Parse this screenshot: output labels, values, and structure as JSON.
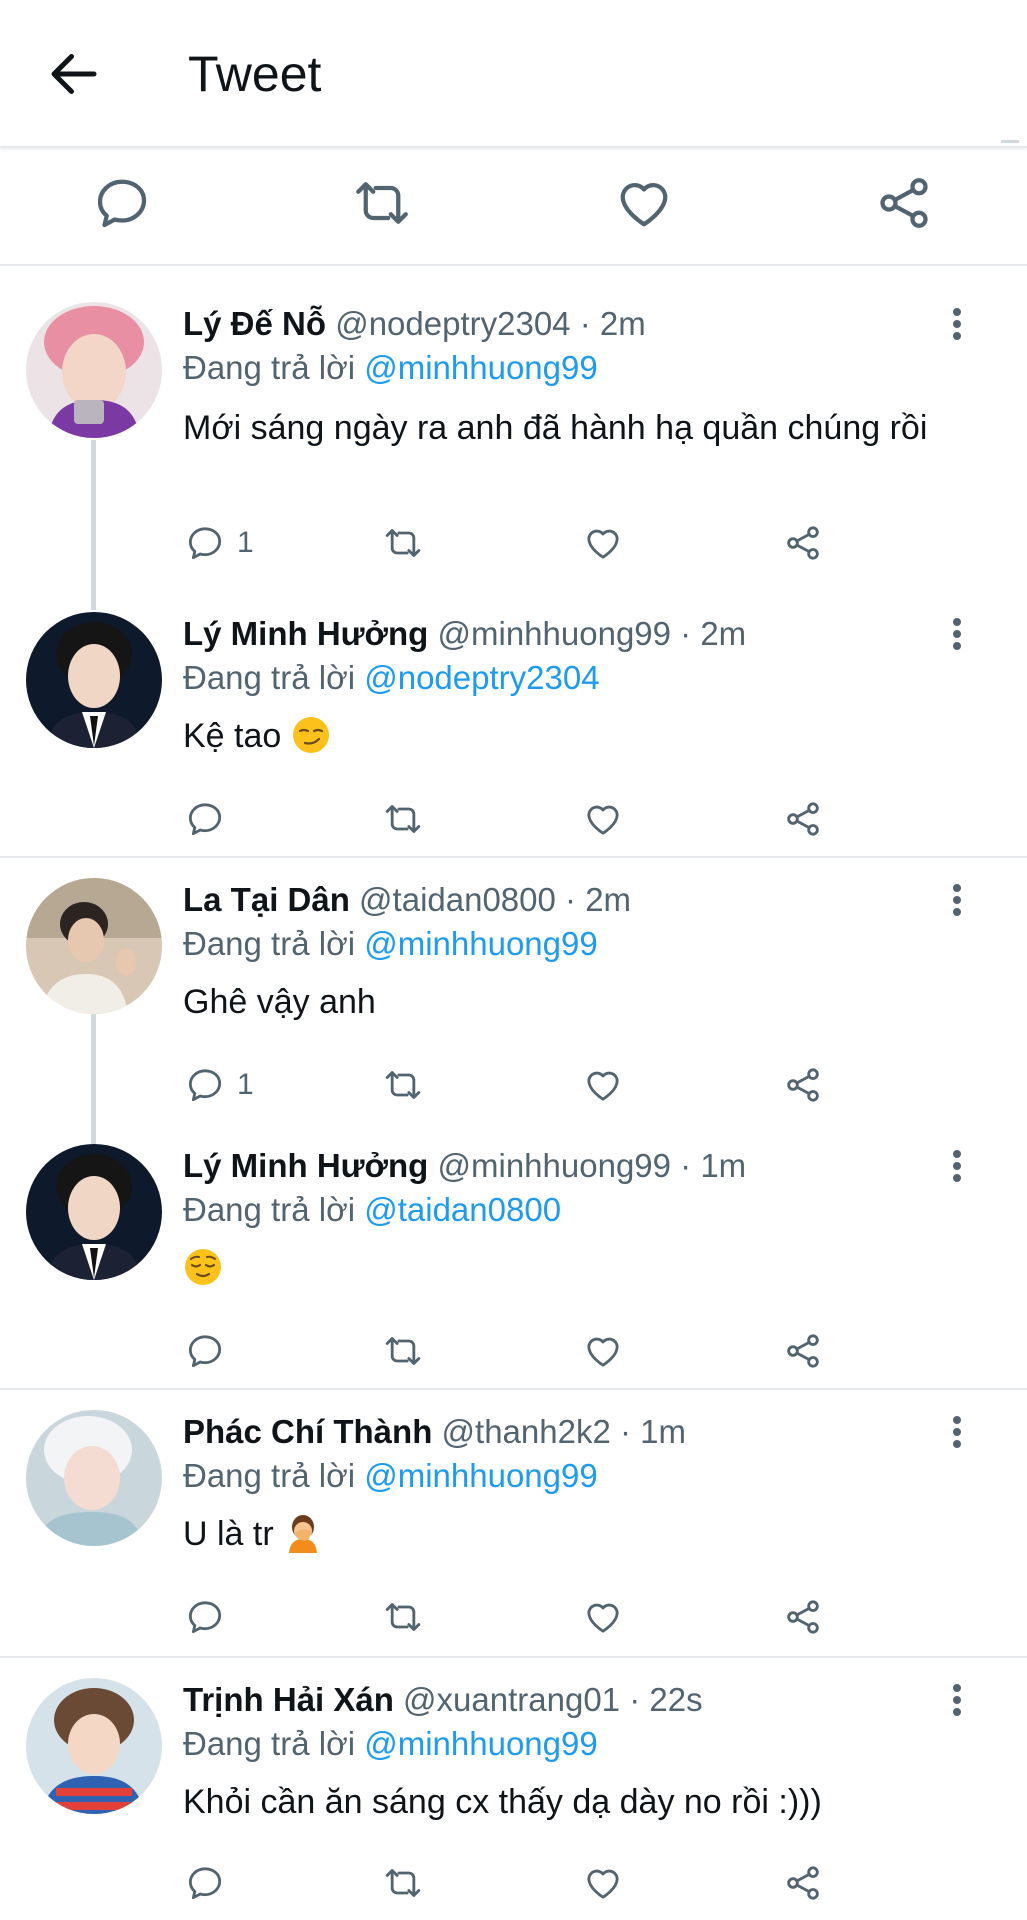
{
  "header": {
    "title": "Tweet"
  },
  "replying_prefix": "Đang trả lời",
  "colors": {
    "accent": "#1d9bf0",
    "secondary_text": "#536471",
    "divider": "#e6e9ec"
  },
  "tweets": [
    {
      "name": "Lý Đế Nỗ",
      "handle": "@nodeptry2304",
      "time": "· 2m",
      "reply_to": "@minhhuong99",
      "text": "Mới sáng ngày ra anh đã hành hạ quần chúng rồi",
      "emoji": "",
      "reply_count": "1"
    },
    {
      "name": "Lý Minh Hưởng",
      "handle": "@minhhuong99",
      "time": "· 2m",
      "reply_to": "@nodeptry2304",
      "text": "Kệ tao",
      "emoji": "smirking-face",
      "reply_count": ""
    },
    {
      "name": "La Tại Dân",
      "handle": "@taidan0800",
      "time": "· 2m",
      "reply_to": "@minhhuong99",
      "text": "Ghê vậy anh",
      "emoji": "",
      "reply_count": "1"
    },
    {
      "name": "Lý Minh Hưởng",
      "handle": "@minhhuong99",
      "time": "· 1m",
      "reply_to": "@taidan0800",
      "text": "",
      "emoji": "relieved-face",
      "reply_count": ""
    },
    {
      "name": "Phác Chí Thành",
      "handle": "@thanh2k2",
      "time": "· 1m",
      "reply_to": "@minhhuong99",
      "text": "U là tr",
      "emoji": "person-facepalming",
      "reply_count": ""
    },
    {
      "name": "Trịnh Hải Xán",
      "handle": "@xuantrang01",
      "time": "· 22s",
      "reply_to": "@minhhuong99",
      "text": "Khỏi cần ăn sáng cx thấy dạ dày no rồi :)))",
      "emoji": "",
      "reply_count": ""
    }
  ]
}
